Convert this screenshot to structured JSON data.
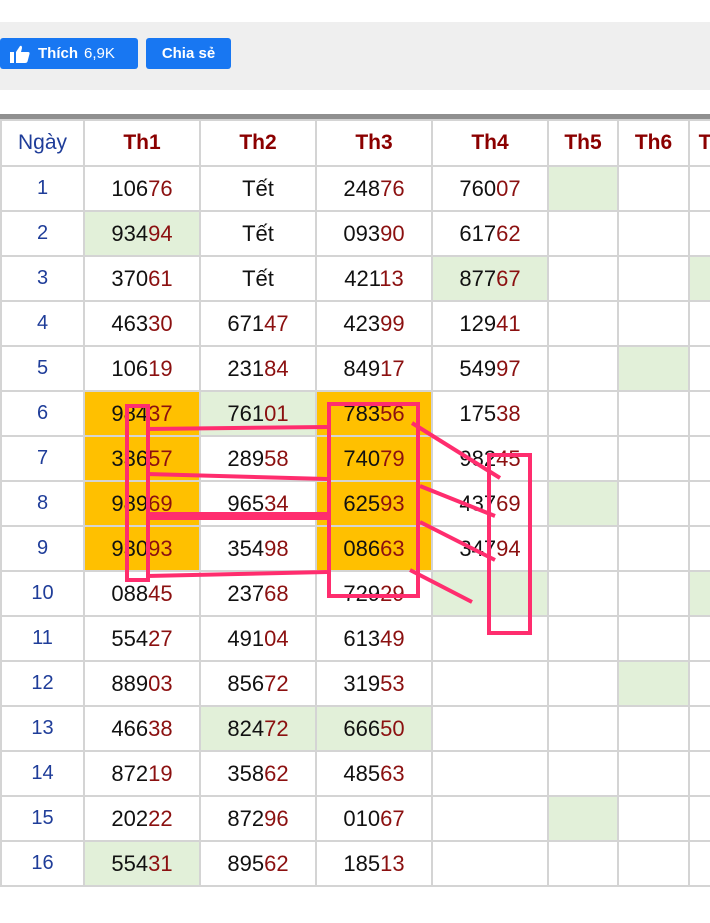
{
  "social": {
    "like_label": "Thích",
    "like_count": "6,9K",
    "share_label": "Chia sẻ"
  },
  "table": {
    "headers": [
      "Ngày",
      "Th1",
      "Th2",
      "Th3",
      "Th4",
      "Th5",
      "Th6",
      "T"
    ],
    "rows": [
      {
        "day": "1",
        "cells": [
          [
            "106",
            "76"
          ],
          [
            "Tết",
            ""
          ],
          [
            "248",
            "76"
          ],
          [
            "760",
            "07"
          ],
          null,
          null,
          null
        ]
      },
      {
        "day": "2",
        "cells": [
          [
            "934",
            "94"
          ],
          [
            "Tết",
            ""
          ],
          [
            "093",
            "90"
          ],
          [
            "617",
            "62"
          ],
          null,
          null,
          null
        ]
      },
      {
        "day": "3",
        "cells": [
          [
            "370",
            "61"
          ],
          [
            "Tết",
            ""
          ],
          [
            "421",
            "13"
          ],
          [
            "877",
            "67"
          ],
          null,
          null,
          null
        ]
      },
      {
        "day": "4",
        "cells": [
          [
            "463",
            "30"
          ],
          [
            "671",
            "47"
          ],
          [
            "423",
            "99"
          ],
          [
            "129",
            "41"
          ],
          null,
          null,
          null
        ]
      },
      {
        "day": "5",
        "cells": [
          [
            "106",
            "19"
          ],
          [
            "231",
            "84"
          ],
          [
            "849",
            "17"
          ],
          [
            "549",
            "97"
          ],
          null,
          null,
          null
        ]
      },
      {
        "day": "6",
        "cells": [
          [
            "984",
            "37"
          ],
          [
            "761",
            "01"
          ],
          [
            "783",
            "56"
          ],
          [
            "175",
            "38"
          ],
          null,
          null,
          null
        ]
      },
      {
        "day": "7",
        "cells": [
          [
            "336",
            "57"
          ],
          [
            "289",
            "58"
          ],
          [
            "740",
            "79"
          ],
          [
            "982",
            "45"
          ],
          null,
          null,
          null
        ]
      },
      {
        "day": "8",
        "cells": [
          [
            "989",
            "69"
          ],
          [
            "965",
            "34"
          ],
          [
            "625",
            "93"
          ],
          [
            "437",
            "69"
          ],
          null,
          null,
          null
        ]
      },
      {
        "day": "9",
        "cells": [
          [
            "930",
            "93"
          ],
          [
            "354",
            "98"
          ],
          [
            "086",
            "63"
          ],
          [
            "347",
            "94"
          ],
          null,
          null,
          null
        ]
      },
      {
        "day": "10",
        "cells": [
          [
            "088",
            "45"
          ],
          [
            "237",
            "68"
          ],
          [
            "729",
            "29"
          ],
          null,
          null,
          null,
          null
        ]
      },
      {
        "day": "11",
        "cells": [
          [
            "554",
            "27"
          ],
          [
            "491",
            "04"
          ],
          [
            "613",
            "49"
          ],
          null,
          null,
          null,
          null
        ]
      },
      {
        "day": "12",
        "cells": [
          [
            "889",
            "03"
          ],
          [
            "856",
            "72"
          ],
          [
            "319",
            "53"
          ],
          null,
          null,
          null,
          null
        ]
      },
      {
        "day": "13",
        "cells": [
          [
            "466",
            "38"
          ],
          [
            "824",
            "72"
          ],
          [
            "666",
            "50"
          ],
          null,
          null,
          null,
          null
        ]
      },
      {
        "day": "14",
        "cells": [
          [
            "872",
            "19"
          ],
          [
            "358",
            "62"
          ],
          [
            "485",
            "63"
          ],
          null,
          null,
          null,
          null
        ]
      },
      {
        "day": "15",
        "cells": [
          [
            "202",
            "22"
          ],
          [
            "872",
            "96"
          ],
          [
            "010",
            "67"
          ],
          null,
          null,
          null,
          null
        ]
      },
      {
        "day": "16",
        "cells": [
          [
            "554",
            "31"
          ],
          [
            "895",
            "62"
          ],
          [
            "185",
            "13"
          ],
          null,
          null,
          null,
          null
        ]
      }
    ]
  },
  "colors": {
    "header_text": "#8b0000",
    "day_text": "#1f3d99",
    "highlight_green": "#e2f0d9",
    "highlight_orange": "#ffc000",
    "annotation": "#ff2d6e",
    "facebook_blue": "#1877f2"
  }
}
